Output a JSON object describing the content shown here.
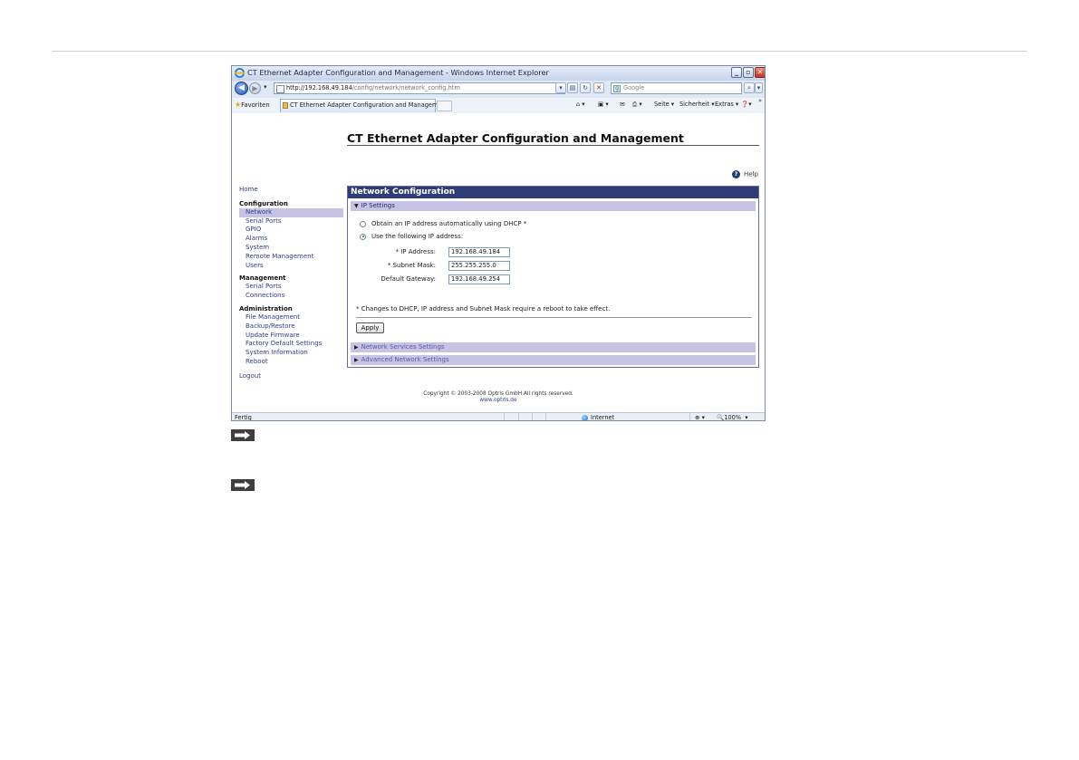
{
  "window": {
    "title": "CT Ethernet Adapter Configuration and Management - Windows Internet Explorer",
    "url_host": "http://192.168.49.184",
    "url_path": "/config/network/network_config.htm",
    "search_placeholder": "Google"
  },
  "favorites_bar": {
    "favorites_label": "Favoriten",
    "tab_title": "CT Ethernet Adapter Configuration and Management",
    "commands": [
      "Seite ▾",
      "Sicherheit ▾",
      "Extras ▾"
    ]
  },
  "page": {
    "title": "CT Ethernet Adapter Configuration and Management",
    "help_label": "Help"
  },
  "sidebar": {
    "home": "Home",
    "configuration": {
      "heading": "Configuration",
      "items": [
        "Network",
        "Serial Ports",
        "GPIO",
        "Alarms",
        "System",
        "Remote Management",
        "Users"
      ],
      "active": "Network"
    },
    "management": {
      "heading": "Management",
      "items": [
        "Serial Ports",
        "Connections"
      ]
    },
    "administration": {
      "heading": "Administration",
      "items": [
        "File Management",
        "Backup/Restore",
        "Update Firmware",
        "Factory Default Settings",
        "System Information",
        "Reboot"
      ]
    },
    "logout": "Logout"
  },
  "panel": {
    "heading": "Network Configuration",
    "ip_section": "IP Settings",
    "dhcp_option": "Obtain an IP address automatically using DHCP *",
    "static_option": "Use the following IP address:",
    "selected_option": "static",
    "fields": {
      "ip_label": "* IP Address:",
      "ip_value": "192.168.49.184",
      "mask_label": "* Subnet Mask:",
      "mask_value": "255.255.255.0",
      "gateway_label": "Default Gateway:",
      "gateway_value": "192.168.49.254"
    },
    "note": "* Changes to DHCP, IP address and Subnet Mask require a reboot to take effect.",
    "apply_label": "Apply",
    "network_services": "Network Services Settings",
    "advanced_network": "Advanced Network Settings"
  },
  "footer": {
    "copyright": "Copyright © 2003-2008 Optris GmbH All rights reserved.",
    "website": "www.optris.de"
  },
  "statusbar": {
    "status": "Fertig",
    "zone": "Internet",
    "zoom": "100%"
  },
  "icons": [
    "ie-logo-icon",
    "back-icon",
    "forward-icon",
    "refresh-icon",
    "stop-icon",
    "search-icon",
    "star-icon",
    "home-icon",
    "feed-icon",
    "mail-icon",
    "print-icon",
    "help-icon",
    "globe-icon",
    "arrow-right-icon"
  ]
}
